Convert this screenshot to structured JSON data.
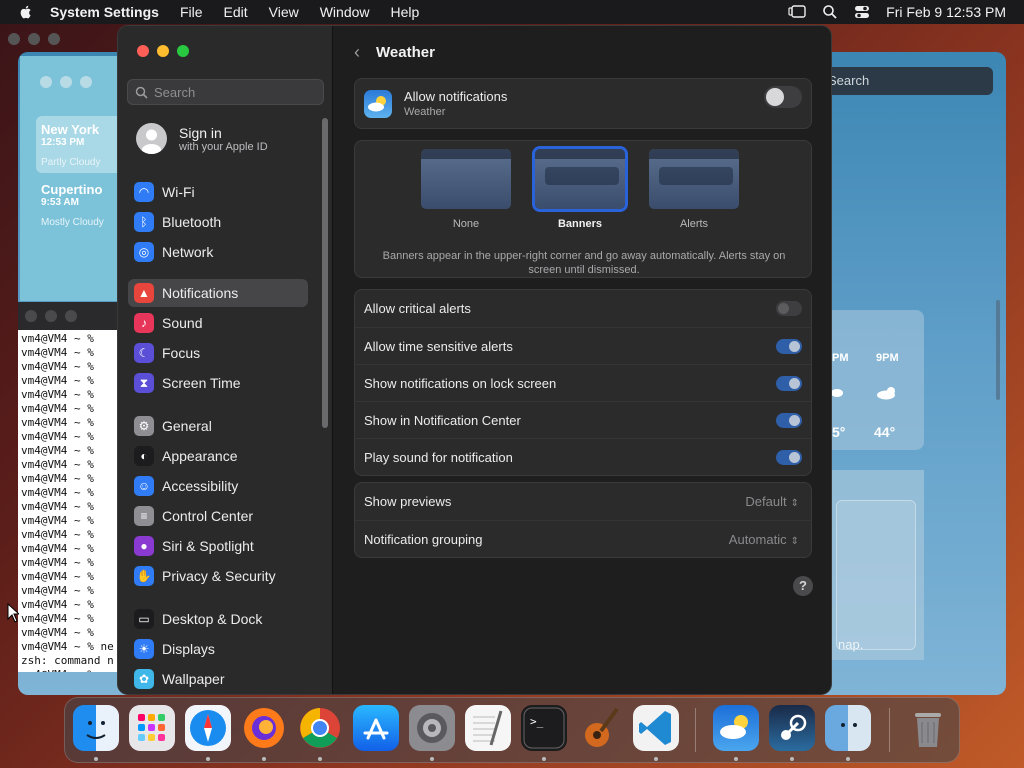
{
  "menubar": {
    "app_name": "System Settings",
    "items": [
      "File",
      "Edit",
      "View",
      "Window",
      "Help"
    ],
    "clock": "Fri Feb 9  12:53 PM"
  },
  "weather_window": {
    "search_placeholder": "Search",
    "cities": [
      {
        "name": "New York",
        "time": "12:53 PM",
        "condition": "Partly Cloudy"
      },
      {
        "name": "Cupertino",
        "time": "9:53 AM",
        "condition": "Mostly Cloudy"
      }
    ],
    "hourly": {
      "hour1": "PM",
      "hour2": "9PM",
      "temp1": "5°",
      "temp2": "44°"
    },
    "map_label": "nap."
  },
  "terminal": {
    "lines": [
      "vm4@VM4 ~ %",
      "vm4@VM4 ~ %",
      "vm4@VM4 ~ %",
      "vm4@VM4 ~ %",
      "vm4@VM4 ~ %",
      "vm4@VM4 ~ %",
      "vm4@VM4 ~ %",
      "vm4@VM4 ~ %",
      "vm4@VM4 ~ %",
      "vm4@VM4 ~ %",
      "vm4@VM4 ~ %",
      "vm4@VM4 ~ %",
      "vm4@VM4 ~ %",
      "vm4@VM4 ~ %",
      "vm4@VM4 ~ %",
      "vm4@VM4 ~ %",
      "vm4@VM4 ~ %",
      "vm4@VM4 ~ %",
      "vm4@VM4 ~ %",
      "vm4@VM4 ~ %",
      "vm4@VM4 ~ %",
      "vm4@VM4 ~ %",
      "vm4@VM4 ~ % ne",
      "zsh: command n",
      "vm4@VM4 ~ % "
    ]
  },
  "settings": {
    "search_placeholder": "Search",
    "signin": {
      "title": "Sign in",
      "subtitle": "with your Apple ID"
    },
    "sidebar": [
      {
        "label": "Wi-Fi",
        "icon": "wifi-icon",
        "color": "#2f7cf6"
      },
      {
        "label": "Bluetooth",
        "icon": "bluetooth-icon",
        "color": "#2f7cf6"
      },
      {
        "label": "Network",
        "icon": "globe-icon",
        "color": "#2f7cf6"
      },
      {
        "label": "Notifications",
        "icon": "bell-icon",
        "color": "#e8463c",
        "selected": true
      },
      {
        "label": "Sound",
        "icon": "speaker-icon",
        "color": "#e8365a"
      },
      {
        "label": "Focus",
        "icon": "moon-icon",
        "color": "#5a4fd6"
      },
      {
        "label": "Screen Time",
        "icon": "hourglass-icon",
        "color": "#5a4fd6"
      },
      {
        "label": "General",
        "icon": "gear-icon",
        "color": "#8e8e93"
      },
      {
        "label": "Appearance",
        "icon": "appearance-icon",
        "color": "#1c1c1e"
      },
      {
        "label": "Accessibility",
        "icon": "accessibility-icon",
        "color": "#2f7cf6"
      },
      {
        "label": "Control Center",
        "icon": "control-center-icon",
        "color": "#8e8e93"
      },
      {
        "label": "Siri & Spotlight",
        "icon": "siri-icon",
        "color": "#8a3ad0"
      },
      {
        "label": "Privacy & Security",
        "icon": "hand-icon",
        "color": "#2f7cf6"
      },
      {
        "label": "Desktop & Dock",
        "icon": "dock-icon",
        "color": "#1c1c1e"
      },
      {
        "label": "Displays",
        "icon": "sun-icon",
        "color": "#2f7cf6"
      },
      {
        "label": "Wallpaper",
        "icon": "wallpaper-icon",
        "color": "#3fb7e8"
      }
    ],
    "content": {
      "title": "Weather",
      "allow": {
        "title": "Allow notifications",
        "subtitle": "Weather",
        "enabled": false
      },
      "styles": [
        {
          "label": "None",
          "selected": false
        },
        {
          "label": "Banners",
          "selected": true
        },
        {
          "label": "Alerts",
          "selected": false
        }
      ],
      "style_description": "Banners appear in the upper-right corner and go away automatically. Alerts stay on screen until dismissed.",
      "toggles": [
        {
          "label": "Allow critical alerts",
          "on": false
        },
        {
          "label": "Allow time sensitive alerts",
          "on": true
        },
        {
          "label": "Show notifications on lock screen",
          "on": true
        },
        {
          "label": "Show in Notification Center",
          "on": true
        },
        {
          "label": "Play sound for notification",
          "on": true
        }
      ],
      "popups": [
        {
          "label": "Show previews",
          "value": "Default"
        },
        {
          "label": "Notification grouping",
          "value": "Automatic"
        }
      ],
      "help": "?"
    }
  },
  "dock": {
    "apps": [
      "finder-icon",
      "launchpad-icon",
      "safari-icon",
      "firefox-icon",
      "chrome-icon",
      "app-store-icon",
      "system-settings-icon",
      "textedit-icon",
      "terminal-icon",
      "garageband-icon",
      "vscode-icon",
      "weather-icon",
      "steam-icon",
      "preview-icon",
      "trash-icon"
    ]
  }
}
